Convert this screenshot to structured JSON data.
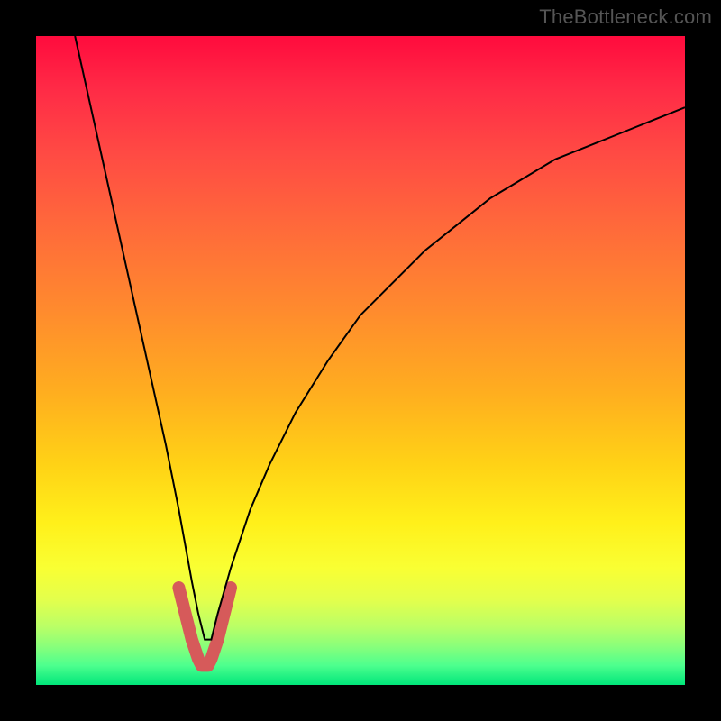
{
  "watermark": "TheBottleneck.com",
  "chart_data": {
    "type": "line",
    "title": "",
    "xlabel": "",
    "ylabel": "",
    "xlim": [
      0,
      100
    ],
    "ylim": [
      0,
      100
    ],
    "grid": false,
    "legend": false,
    "series": [
      {
        "name": "bottleneck-curve",
        "x": [
          6,
          8,
          10,
          12,
          14,
          16,
          18,
          20,
          22,
          24,
          25,
          26,
          27,
          28,
          30,
          33,
          36,
          40,
          45,
          50,
          55,
          60,
          65,
          70,
          75,
          80,
          85,
          90,
          95,
          100
        ],
        "y": [
          100,
          91,
          82,
          73,
          64,
          55,
          46,
          37,
          27,
          16,
          11,
          7,
          7,
          11,
          18,
          27,
          34,
          42,
          50,
          57,
          62,
          67,
          71,
          75,
          78,
          81,
          83,
          85,
          87,
          89
        ],
        "stroke": "#000000",
        "stroke_width": 2
      },
      {
        "name": "sweet-spot-overlay",
        "x": [
          22,
          23,
          24,
          25,
          25.5,
          26,
          26.5,
          27,
          28,
          29,
          30
        ],
        "y": [
          15,
          11,
          7,
          4,
          3,
          3,
          3,
          4,
          7,
          11,
          15
        ],
        "stroke": "#d65a5a",
        "stroke_width": 14,
        "linecap": "round"
      }
    ],
    "background_gradient": {
      "direction": "top-to-bottom",
      "stops": [
        {
          "pos": 0.0,
          "color": "#ff0b3d"
        },
        {
          "pos": 0.3,
          "color": "#ff6b3a"
        },
        {
          "pos": 0.66,
          "color": "#ffd216"
        },
        {
          "pos": 0.82,
          "color": "#f9ff33"
        },
        {
          "pos": 1.0,
          "color": "#00e67a"
        }
      ]
    }
  }
}
